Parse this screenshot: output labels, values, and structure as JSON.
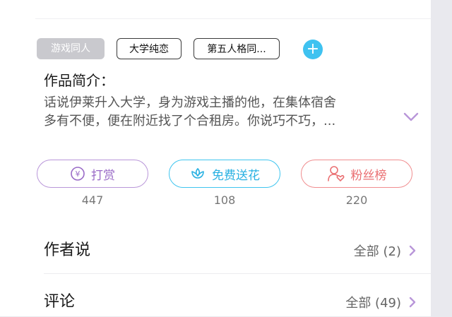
{
  "tags": {
    "active": "游戏同人",
    "items": [
      "大学纯恋",
      "第五人格同..."
    ],
    "add": "+"
  },
  "intro": {
    "title": "作品简介：",
    "line1": "话说伊莱升入大学，身为游戏主播的他，在集体宿舍",
    "line2": "多有不便，便在附近找了个合租房。你说巧不巧，..."
  },
  "actions": [
    {
      "label": "打赏",
      "count": "447",
      "icon": "yen-coin-icon",
      "color": "#9a6bc7"
    },
    {
      "label": "免费送花",
      "count": "108",
      "icon": "flower-icon",
      "color": "#29b1e2"
    },
    {
      "label": "粉丝榜",
      "count": "220",
      "icon": "user-heart-icon",
      "color": "#ea6f72"
    }
  ],
  "sections": {
    "author": {
      "title": "作者说",
      "link": "全部 (2)"
    },
    "comments": {
      "title": "评论",
      "link": "全部 (49)"
    }
  },
  "colors": {
    "accent": "#b996d9",
    "tag_bg": "#c9c9ce",
    "add_btn": "#3fc2f0"
  }
}
